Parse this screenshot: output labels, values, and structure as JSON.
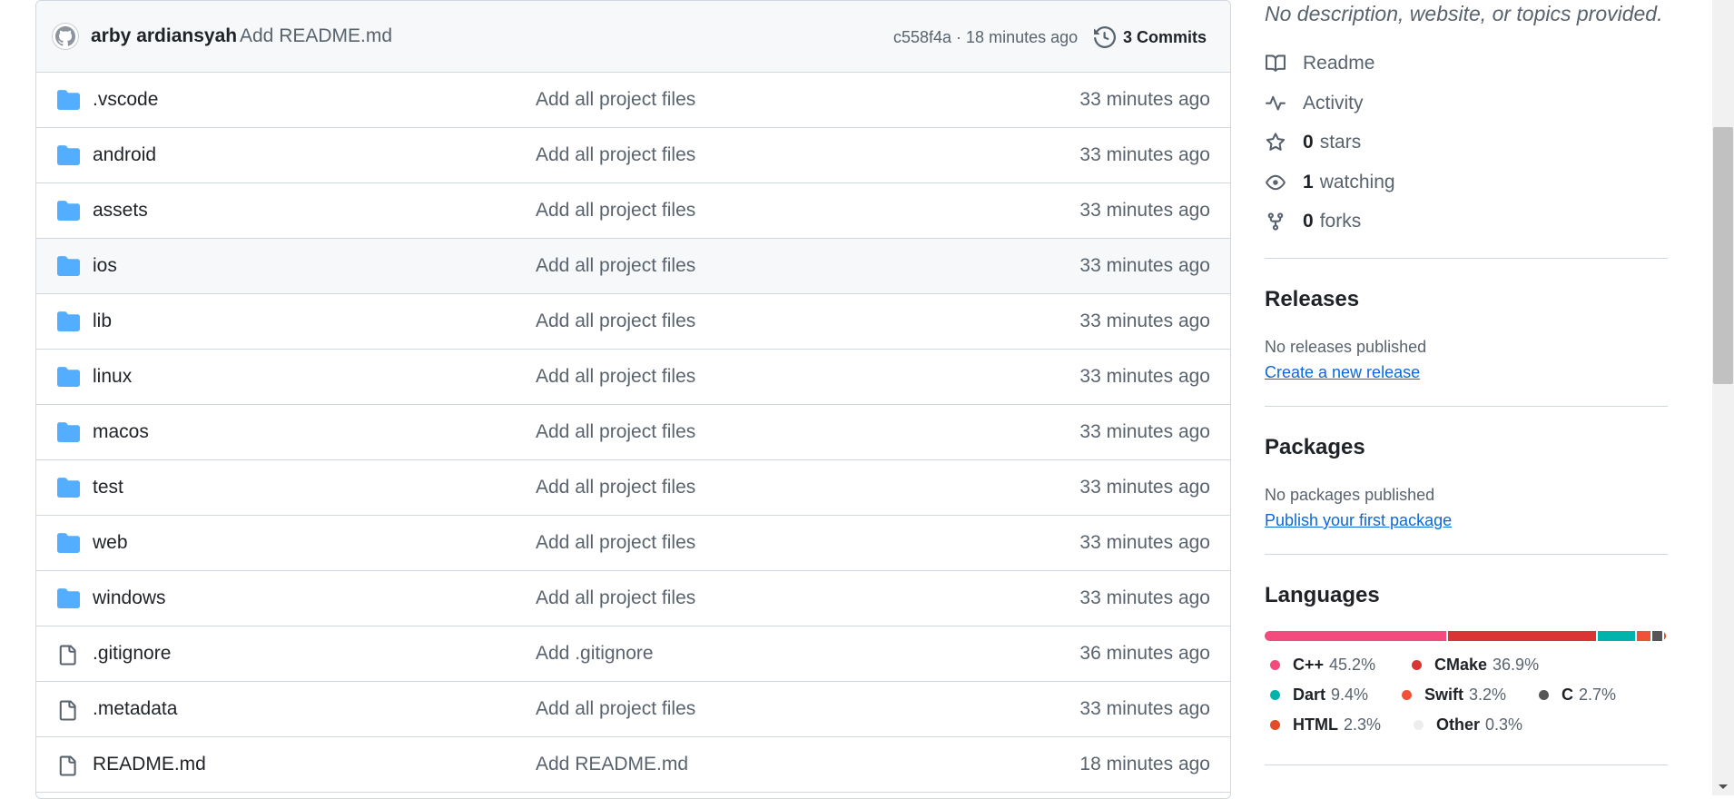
{
  "commit": {
    "author": "arby ardiansyah",
    "message": "Add README.md",
    "meta": "c558f4a · 18 minutes ago",
    "commits_label": "3 Commits"
  },
  "files": [
    {
      "name": ".vscode",
      "type": "folder",
      "commit": "Add all project files",
      "age": "33 minutes ago"
    },
    {
      "name": "android",
      "type": "folder",
      "commit": "Add all project files",
      "age": "33 minutes ago"
    },
    {
      "name": "assets",
      "type": "folder",
      "commit": "Add all project files",
      "age": "33 minutes ago"
    },
    {
      "name": "ios",
      "type": "folder",
      "commit": "Add all project files",
      "age": "33 minutes ago"
    },
    {
      "name": "lib",
      "type": "folder",
      "commit": "Add all project files",
      "age": "33 minutes ago"
    },
    {
      "name": "linux",
      "type": "folder",
      "commit": "Add all project files",
      "age": "33 minutes ago"
    },
    {
      "name": "macos",
      "type": "folder",
      "commit": "Add all project files",
      "age": "33 minutes ago"
    },
    {
      "name": "test",
      "type": "folder",
      "commit": "Add all project files",
      "age": "33 minutes ago"
    },
    {
      "name": "web",
      "type": "folder",
      "commit": "Add all project files",
      "age": "33 minutes ago"
    },
    {
      "name": "windows",
      "type": "folder",
      "commit": "Add all project files",
      "age": "33 minutes ago"
    },
    {
      "name": ".gitignore",
      "type": "file",
      "commit": "Add .gitignore",
      "age": "36 minutes ago"
    },
    {
      "name": ".metadata",
      "type": "file",
      "commit": "Add all project files",
      "age": "33 minutes ago"
    },
    {
      "name": "README.md",
      "type": "file",
      "commit": "Add README.md",
      "age": "18 minutes ago"
    }
  ],
  "about": {
    "description": "No description, website, or topics provided.",
    "readme": "Readme",
    "activity": "Activity",
    "stars_count": "0",
    "stars_label": "stars",
    "watching_count": "1",
    "watching_label": "watching",
    "forks_count": "0",
    "forks_label": "forks"
  },
  "releases": {
    "title": "Releases",
    "text": "No releases published",
    "link": "Create a new release"
  },
  "packages": {
    "title": "Packages",
    "text": "No packages published",
    "link": "Publish your first package"
  },
  "languages": {
    "title": "Languages",
    "items": [
      {
        "name": "C++",
        "percent": "45.2%",
        "value": 45.2,
        "color": "#f34b7d"
      },
      {
        "name": "CMake",
        "percent": "36.9%",
        "value": 36.9,
        "color": "#da3434"
      },
      {
        "name": "Dart",
        "percent": "9.4%",
        "value": 9.4,
        "color": "#00b4ab"
      },
      {
        "name": "Swift",
        "percent": "3.2%",
        "value": 3.2,
        "color": "#f05138"
      },
      {
        "name": "C",
        "percent": "2.7%",
        "value": 2.7,
        "color": "#555555"
      },
      {
        "name": "HTML",
        "percent": "2.3%",
        "value": 2.3,
        "color": "#e34c26"
      },
      {
        "name": "Other",
        "percent": "0.3%",
        "value": 0.3,
        "color": "#ededed"
      }
    ]
  }
}
